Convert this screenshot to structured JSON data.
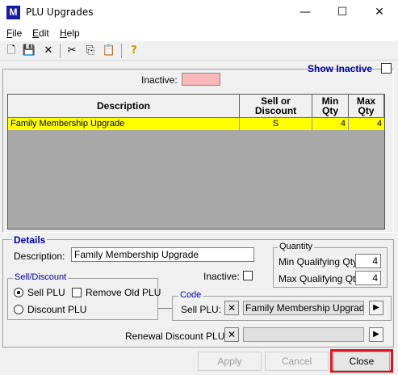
{
  "window": {
    "app_icon_letter": "M",
    "title": "PLU Upgrades",
    "minimize_glyph": "—",
    "maximize_glyph": "☐",
    "close_glyph": "✕"
  },
  "menu": [
    {
      "label": "File",
      "accel": "F",
      "rest": "ile"
    },
    {
      "label": "Edit",
      "accel": "E",
      "rest": "dit"
    },
    {
      "label": "Help",
      "accel": "H",
      "rest": "elp"
    }
  ],
  "toolbar": {
    "icons": [
      "new-icon",
      "save-icon",
      "delete-icon",
      "cut-icon",
      "copy-icon",
      "paste-icon",
      "help-icon"
    ],
    "glyphs": [
      "🗋",
      "💾",
      "✕",
      "✂",
      "⎘",
      "📋",
      "?"
    ]
  },
  "show_inactive_label": "Show Inactive",
  "inactive_legend_label": "Inactive:",
  "inactive_color": "#f8b8b8",
  "grid": {
    "columns": [
      "Description",
      "Sell or Discount",
      "Min Qty",
      "Max Qty"
    ],
    "rows": [
      {
        "description": "Family Membership Upgrade",
        "sell_or_discount": "S",
        "min_qty": "4",
        "max_qty": "4"
      }
    ],
    "selected_row_color": "#ffff00"
  },
  "details": {
    "legend": "Details",
    "description_label": "Description:",
    "description_value": "Family Membership Upgrade",
    "inactive_label": "Inactive:",
    "inactive_checked": false,
    "quantity": {
      "legend": "Quantity",
      "min_label": "Min Qualifying Qty:",
      "min_value": "4",
      "max_label": "Max Qualifying Qty:",
      "max_value": "4"
    },
    "sell_discount": {
      "legend": "Sell/Discount",
      "sell_label": "Sell PLU",
      "sell_selected": true,
      "remove_old_label": "Remove Old PLU",
      "remove_old_checked": false,
      "discount_label": "Discount PLU",
      "discount_selected": false
    },
    "code": {
      "legend": "Code",
      "sell_plu_label": "Sell PLU:",
      "sell_plu_value": "Family Membership Upgrade",
      "clear_glyph": "✕",
      "arrow_glyph": "▶"
    },
    "renewal_label": "Renewal Discount PLU:",
    "renewal_value": ""
  },
  "buttons": {
    "apply": "Apply",
    "cancel": "Cancel",
    "close": "Close"
  }
}
